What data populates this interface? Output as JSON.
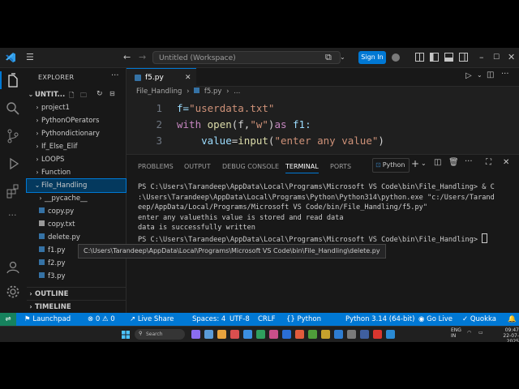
{
  "titlebar": {
    "workspace_title": "Untitled (Workspace)",
    "signin_label": "Sign In"
  },
  "sidebar": {
    "title": "EXPLORER",
    "root_label": "UNTIT...",
    "items": [
      {
        "label": "project1",
        "kind": "folder",
        "open": false
      },
      {
        "label": "PythonOPerators",
        "kind": "folder",
        "open": false
      },
      {
        "label": "Pythondictionary",
        "kind": "folder",
        "open": false
      },
      {
        "label": "If_Else_Elif",
        "kind": "folder",
        "open": false
      },
      {
        "label": "LOOPS",
        "kind": "folder",
        "open": false
      },
      {
        "label": "Function",
        "kind": "folder",
        "open": false
      },
      {
        "label": "File_Handling",
        "kind": "folder",
        "open": true
      },
      {
        "label": "__pycache__",
        "kind": "folder",
        "open": false
      },
      {
        "label": "copy.py",
        "kind": "file"
      },
      {
        "label": "copy.txt",
        "kind": "file"
      },
      {
        "label": "delete.py",
        "kind": "file"
      },
      {
        "label": "f1.py",
        "kind": "file"
      },
      {
        "label": "f2.py",
        "kind": "file"
      },
      {
        "label": "f3.py",
        "kind": "file"
      }
    ],
    "outline_label": "OUTLINE",
    "timeline_label": "TIMELINE"
  },
  "editor": {
    "tab_label": "f5.py",
    "breadcrumb": [
      "File_Handling",
      "f5.py",
      "..."
    ],
    "lines": [
      {
        "num": "1",
        "tokens": [
          {
            "t": "f=",
            "c": "#9cdcfe"
          },
          {
            "t": "\"userdata.txt\"",
            "c": "#ce9178"
          }
        ]
      },
      {
        "num": "2",
        "tokens": [
          {
            "t": "with ",
            "c": "#c586c0"
          },
          {
            "t": "open",
            "c": "#dcdcaa"
          },
          {
            "t": "(f,",
            "c": "#d4d4d4"
          },
          {
            "t": "\"w\"",
            "c": "#ce9178"
          },
          {
            "t": ")",
            "c": "#d4d4d4"
          },
          {
            "t": "as ",
            "c": "#c586c0"
          },
          {
            "t": "f1:",
            "c": "#9cdcfe"
          }
        ]
      },
      {
        "num": "3",
        "tokens": [
          {
            "t": "    value",
            "c": "#9cdcfe"
          },
          {
            "t": "=",
            "c": "#d4d4d4"
          },
          {
            "t": "input",
            "c": "#dcdcaa"
          },
          {
            "t": "(",
            "c": "#d4d4d4"
          },
          {
            "t": "\"enter any value\"",
            "c": "#ce9178"
          },
          {
            "t": ")",
            "c": "#d4d4d4"
          }
        ]
      }
    ]
  },
  "panel": {
    "tabs": [
      "PROBLEMS",
      "OUTPUT",
      "DEBUG CONSOLE",
      "TERMINAL",
      "PORTS"
    ],
    "active_tab": "TERMINAL",
    "terminal_profile": "Python",
    "terminal_lines": [
      "PS C:\\Users\\Tarandeep\\AppData\\Local\\Programs\\Microsoft VS Code\\bin\\File_Handling> & C",
      ":\\Users\\Tarandeep\\AppData\\Local\\Programs\\Python\\Python314\\python.exe \"c:/Users/Tarand",
      "eep/AppData/Local/Programs/Microsoft VS Code/bin/File_Handling/f5.py\"",
      "enter any valuethis value is stored and read data",
      "data is successfully written",
      "PS C:\\Users\\Tarandeep\\AppData\\Local\\Programs\\Microsoft VS Code\\bin\\File_Handling> "
    ]
  },
  "tooltip": "C:\\Users\\Tarandeep\\AppData\\Local\\Programs\\Microsoft VS Code\\bin\\File_Handling\\delete.py",
  "statusbar": {
    "launchpad": "Launchpad",
    "errors": "0",
    "warnings": "0",
    "live_share": "Live Share",
    "spaces": "Spaces: 4",
    "encoding": "UTF-8",
    "eol": "CRLF",
    "language": "Python",
    "interpreter": "Python 3.14 (64-bit)",
    "go_live": "Go Live",
    "quokka": "Quokka"
  },
  "taskbar": {
    "search_placeholder": "Search",
    "lang": "ENG",
    "region": "IN",
    "time": "09:47",
    "date": "22-07-2025"
  },
  "colors": {
    "accent": "#0078d4",
    "editor_bg": "#1f1f1f",
    "sidebar_bg": "#181818"
  }
}
